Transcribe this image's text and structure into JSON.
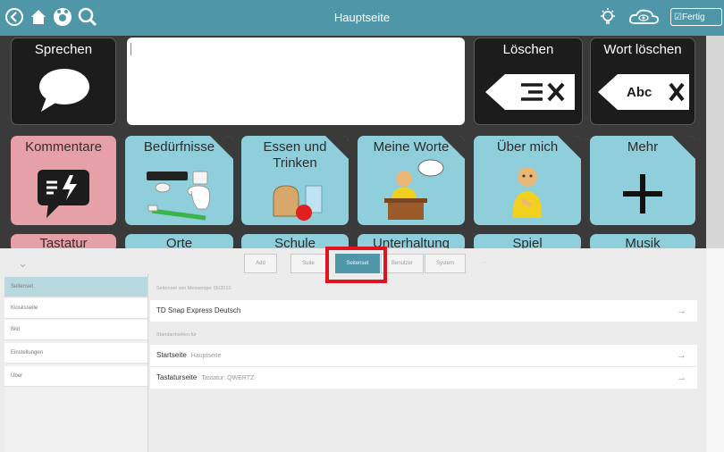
{
  "topbar": {
    "title": "Hauptseite",
    "icons": [
      "back-icon",
      "home-icon",
      "profile-icon",
      "search-icon",
      "lightbulb-icon",
      "cloud-eye-icon",
      "check-icon"
    ],
    "done_label": "Fertig"
  },
  "speak_tile": {
    "label": "Sprechen",
    "icon": "speech-bubble-icon"
  },
  "message_box": {
    "value": ""
  },
  "clear_tile": {
    "label": "Löschen",
    "icon": "clear-all-icon",
    "glyph": "≡X"
  },
  "delete_word_tile": {
    "label": "Wort löschen",
    "icon": "delete-word-icon",
    "glyph": "Abc X"
  },
  "categories": [
    {
      "label": "Kommentare",
      "icon": "comment-bolt-icon"
    },
    {
      "label": "Bedürfnisse",
      "icon": "toiletries-icon"
    },
    {
      "label": "Essen und Trinken",
      "icon": "food-drink-icon"
    },
    {
      "label": "Meine Worte",
      "icon": "speaker-person-icon"
    },
    {
      "label": "Über mich",
      "icon": "person-icon"
    },
    {
      "label": "Mehr",
      "icon": "plus-icon"
    }
  ],
  "partial_row": [
    "Tastatur",
    "Orte",
    "Schule",
    "Unterhaltung",
    "Spiel",
    "Musik"
  ],
  "settings": {
    "tabs": [
      "Add",
      "Suite",
      "Seitenset",
      "Benutzer",
      "System",
      "..."
    ],
    "selected_tab": "Seitenset",
    "sidebar": [
      "Seitenset",
      "Kiosksseite",
      "Bild",
      "Einstellungen",
      "Über"
    ],
    "group1_label": "Seitenset von Messenger 05/2015",
    "pageset_name": "TD Snap Express Deutsch",
    "group2_label": "Standardseiten für",
    "rows": [
      {
        "label": "Startseite",
        "value": "Hauptseite"
      },
      {
        "label": "Tastaturseite",
        "value": "Tastatur: QWERTZ"
      }
    ],
    "arrow_glyph": "→"
  },
  "colors": {
    "accent": "#4f97a8",
    "tile_blue": "#8fcfdb",
    "tile_pink": "#e6a0a8",
    "highlight_red": "#e0141e",
    "grid_bg": "#3a3a3a"
  }
}
